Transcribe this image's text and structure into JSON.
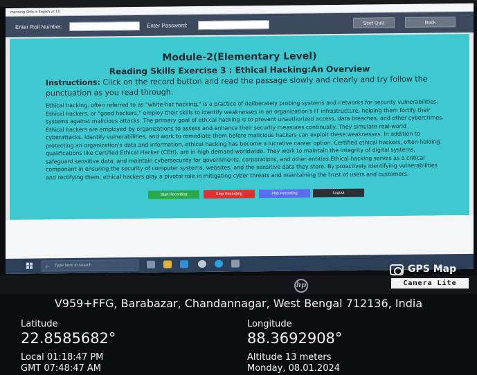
{
  "app": {
    "title": "Improving Skills in English v2.1.0"
  },
  "header": {
    "roll_label": "Enter Roll Number:",
    "roll_value": "",
    "password_label": "Enter Password:",
    "password_value": "",
    "start_quiz": "Start Quiz",
    "back": "Back"
  },
  "content": {
    "module_title": "Module-2(Elementary Level)",
    "exercise_title": "Reading Skills Exercise 3 : Ethical Hacking:An Overview",
    "instructions_label": "Instructions:",
    "instructions_text": " Click on the record button and read the passage slowly and clearly and try follow the punctuation as you read through.",
    "passage": "Ethical hacking, often referred to as \"white-hat hacking,\" is a practice of deliberately probing systems and networks for security vulnerabilities. Ethical hackers, or \"good hackers,\" employ their skills to identify weaknesses in an organization's IT infrastructure, helping them fortify their systems against malicious attacks. The primary goal of ethical hacking is to prevent unauthorized access, data breaches, and other cybercrimes. Ethical hackers are employed by organizations to assess and enhance their security measures continually. They simulate real-world cyberattacks, identify vulnerabilities, and work to remediate them before malicious hackers can exploit these weaknesses. In addition to protecting an organization's data and information, ethical hacking has become a lucrative career option. Certified ethical hackers, often holding qualifications like Certified Ethical Hacker (CEH), are in high demand worldwide. They work to maintain the integrity of digital systems, safeguard sensitive data, and maintain cybersecurity for governments, corporations, and other entities.Ethical hacking serves as a critical component in ensuring the security of computer systems, websites, and the sensitive data they store. By proactively identifying vulnerabilities and rectifying them, ethical hackers play a pivotal role in mitigating cyber threats and maintaining the trust of users and customers."
  },
  "actions": {
    "start_recording": "Start Recording",
    "stop_recording": "Stop Recording",
    "play_recording": "Play Recording",
    "logout": "Logout"
  },
  "taskbar": {
    "search_placeholder": "Type here to search"
  },
  "gps": {
    "app_name": "GPS Map",
    "app_sub": "Camera Lite",
    "address": "V959+FFG, Barabazar, Chandannagar, West Bengal 712136, India",
    "latitude_label": "Latitude",
    "latitude_value": "22.8585682°",
    "longitude_label": "Longitude",
    "longitude_value": "88.3692908°",
    "local_time": "Local 01:18:47 PM",
    "gmt_time": "GMT 07:48:47 AM",
    "altitude": "Altitude 13 meters",
    "date": "Monday, 08.01.2024"
  },
  "colors": {
    "panel": "#3ec8cf",
    "header": "#3b4a5e",
    "start_recording": "#2aa84a",
    "stop_recording": "#e2302f",
    "play_recording": "#5b6cf0",
    "logout": "#2b2f36"
  }
}
